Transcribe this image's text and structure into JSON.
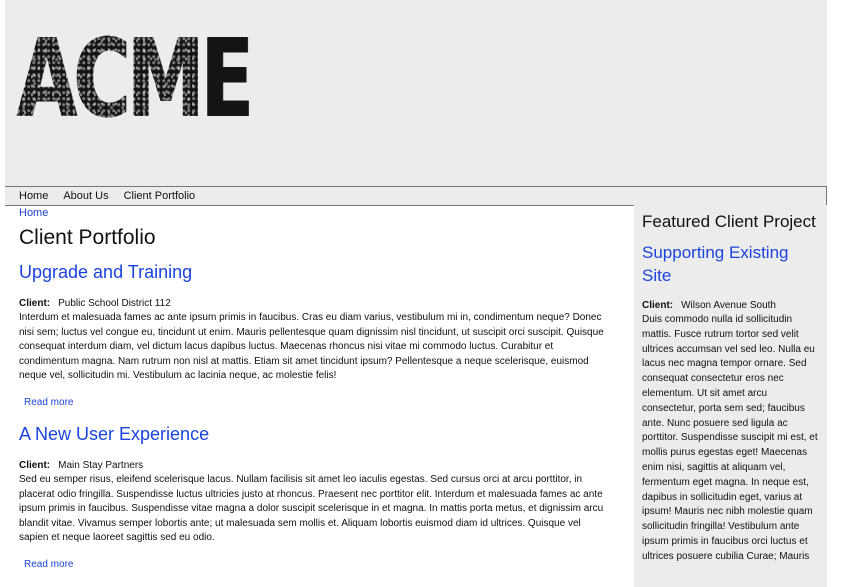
{
  "header": {
    "logo_text": "ACME"
  },
  "nav": {
    "items": [
      {
        "label": "Home"
      },
      {
        "label": "About Us"
      },
      {
        "label": "Client Portfolio"
      }
    ]
  },
  "breadcrumb": {
    "home": "Home"
  },
  "main": {
    "page_title": "Client Portfolio",
    "articles": [
      {
        "title": "Upgrade and Training",
        "client_label": "Client:",
        "client_name": "Public School District 112",
        "body": "Interdum et malesuada fames ac ante ipsum primis in faucibus. Cras eu diam varius, vestibulum mi in, condimentum neque? Donec nisi sem; luctus vel congue eu, tincidunt ut enim. Mauris pellentesque quam dignissim nisl tincidunt, ut suscipit orci suscipit. Quisque consequat interdum diam, vel dictum lacus dapibus luctus. Maecenas rhoncus nisi vitae mi commodo luctus. Curabitur et condimentum magna. Nam rutrum non nisl at mattis. Etiam sit amet tincidunt ipsum? Pellentesque a neque scelerisque, euismod neque vel, sollicitudin mi. Vestibulum ac lacinia neque, ac molestie felis!",
        "read_more": "Read more"
      },
      {
        "title": "A New User Experience",
        "client_label": "Client:",
        "client_name": "Main Stay Partners",
        "body": "Sed eu semper risus, eleifend scelerisque lacus. Nullam facilisis sit amet leo iaculis egestas. Sed cursus orci at arcu porttitor, in placerat odio fringilla. Suspendisse luctus ultricies justo at rhoncus. Praesent nec porttitor elit. Interdum et malesuada fames ac ante ipsum primis in faucibus. Suspendisse vitae magna a dolor suscipit scelerisque in et magna. In mattis porta metus, et dignissim arcu blandit vitae. Vivamus semper lobortis ante; ut malesuada sem mollis et. Aliquam lobortis euismod diam id ultrices. Quisque vel sapien et neque laoreet sagittis sed eu odio.",
        "read_more": "Read more"
      }
    ]
  },
  "sidebar": {
    "heading": "Featured Client Project",
    "project_title": "Supporting Existing Site",
    "client_label": "Client:",
    "client_name": "Wilson Avenue South",
    "body": "Duis commodo nulla id sollicitudin mattis. Fusce rutrum tortor sed velit ultrices accumsan vel sed leo. Nulla eu lacus nec magna tempor ornare. Sed consequat consectetur eros nec elementum. Ut sit amet arcu consectetur, porta sem sed; faucibus ante. Nunc posuere sed ligula ac porttitor. Suspendisse suscipit mi est, et mollis purus egestas eget! Maecenas enim nisi, sagittis at aliquam vel, fermentum eget magna. In neque est, dapibus in sollicitudin eget, varius at ipsum! Mauris nec nibh molestie quam sollicitudin fringilla! Vestibulum ante ipsum primis in faucibus orci luctus et ultrices posuere cubilia Curae; Mauris"
  },
  "colors": {
    "header_bg": "#ececec",
    "link": "#1a44dd",
    "text": "#111111"
  }
}
